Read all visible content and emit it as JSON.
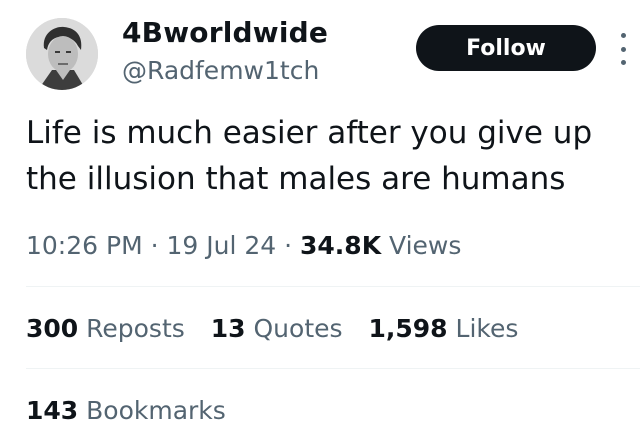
{
  "author": {
    "display_name": "4Bworldwide",
    "username": "@Radfemw1tch",
    "avatar_icon": "user-avatar-photo"
  },
  "follow": {
    "label": "Follow"
  },
  "more_icon": "more-options-icon",
  "tweet": {
    "text_line1": "Life is much easier after you give up",
    "text_line2": "the illusion that males are humans"
  },
  "meta": {
    "time": "10:26 PM",
    "separator": " · ",
    "date": "19 Jul 24",
    "views_count": "34.8K",
    "views_label": "Views"
  },
  "stats": {
    "reposts_count": "300",
    "reposts_label": "Reposts",
    "quotes_count": "13",
    "quotes_label": "Quotes",
    "likes_count": "1,598",
    "likes_label": "Likes",
    "bookmarks_count": "143",
    "bookmarks_label": "Bookmarks"
  },
  "colors": {
    "text_primary": "#0f1419",
    "text_secondary": "#536471",
    "button_bg": "#0f1419",
    "button_text": "#ffffff",
    "divider": "#eff3f4"
  }
}
